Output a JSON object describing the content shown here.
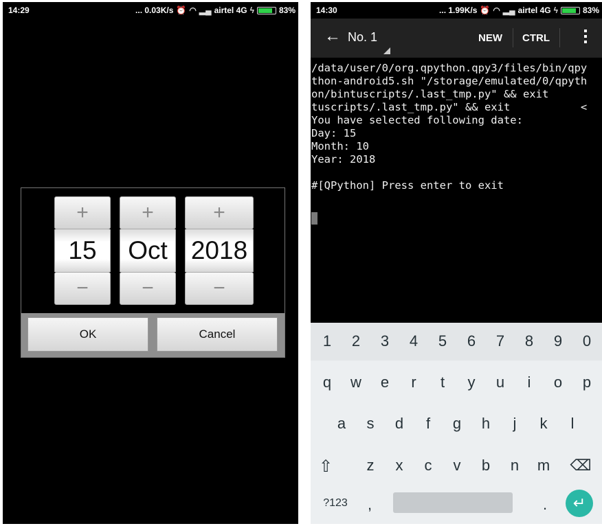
{
  "left_phone": {
    "status": {
      "time": "14:29",
      "info": "... 0.03K/s",
      "carrier": "airtel 4G",
      "battery": "83%",
      "battery_level": 0.83
    },
    "date_picker": {
      "day": {
        "value": "15",
        "plus": "+",
        "minus": "−"
      },
      "month": {
        "value": "Oct",
        "plus": "+",
        "minus": "−"
      },
      "year": {
        "value": "2018",
        "plus": "+",
        "minus": "−"
      },
      "ok_label": "OK",
      "cancel_label": "Cancel"
    }
  },
  "right_phone": {
    "status": {
      "time": "14:30",
      "info": "... 1.99K/s",
      "carrier": "airtel 4G",
      "battery": "83%",
      "battery_level": 0.83
    },
    "appbar": {
      "back_icon": "arrow-left-icon",
      "session": "No. 1",
      "new_label": "NEW",
      "ctrl_label": "CTRL",
      "menu_icon": "overflow-menu-icon"
    },
    "terminal": {
      "lines": [
        "/data/user/0/org.qpython.qpy3/files/bin/qpy",
        "thon-android5.sh \"/storage/emulated/0/qpyth",
        "on/bintuscripts/.last_tmp.py\" && exit",
        "tuscripts/.last_tmp.py\" && exit           <",
        "You have selected following date:",
        "Day: 15",
        "Month: 10",
        "Year: 2018",
        "",
        "#[QPython] Press enter to exit"
      ]
    },
    "keyboard": {
      "numbers": [
        "1",
        "2",
        "3",
        "4",
        "5",
        "6",
        "7",
        "8",
        "9",
        "0"
      ],
      "row1": [
        "q",
        "w",
        "e",
        "r",
        "t",
        "y",
        "u",
        "i",
        "o",
        "p"
      ],
      "row2": [
        "a",
        "s",
        "d",
        "f",
        "g",
        "h",
        "j",
        "k",
        "l"
      ],
      "row3": [
        "z",
        "x",
        "c",
        "v",
        "b",
        "n",
        "m"
      ],
      "shift_icon": "shift-icon",
      "backspace_icon": "backspace-icon",
      "symbols_label": "?123",
      "comma": ",",
      "period": ".",
      "enter_icon": "enter-icon",
      "accent_color": "#2bb8a6"
    }
  }
}
